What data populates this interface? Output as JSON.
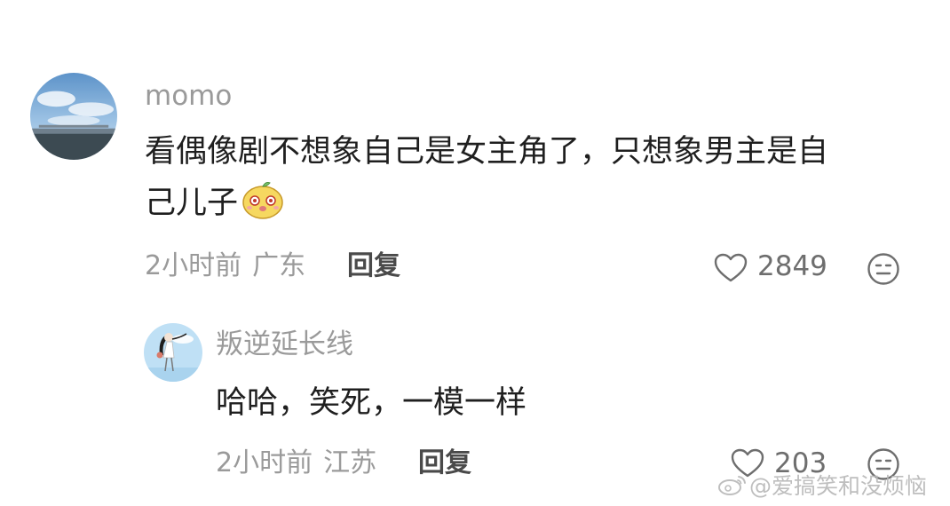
{
  "colors": {
    "username": "#9a9a9a",
    "text": "#1f1f1f",
    "meta": "#9a9a9a",
    "reply": "#4a4a4a",
    "icon": "#6e6e6e"
  },
  "comments": [
    {
      "username": "momo",
      "text_line1": "看偶像剧不想象自己是女主角了，只想象男主是自",
      "text_line2": "己儿子",
      "emoji": "yellow-blob-emoji",
      "time": "2小时前",
      "location": "广东",
      "reply_label": "回复",
      "likes": "2849",
      "like_icon": "heart-icon",
      "more_icon": "smiley-face-icon"
    },
    {
      "username": "叛逆延长线",
      "text": "哈哈，笑死，一模一样",
      "time": "2小时前",
      "location": "江苏",
      "reply_label": "回复",
      "likes": "203",
      "like_icon": "heart-icon",
      "more_icon": "smiley-face-icon"
    }
  ],
  "watermark": {
    "text": "@爱搞笑和没烦恼",
    "icon": "weibo-logo-icon"
  }
}
